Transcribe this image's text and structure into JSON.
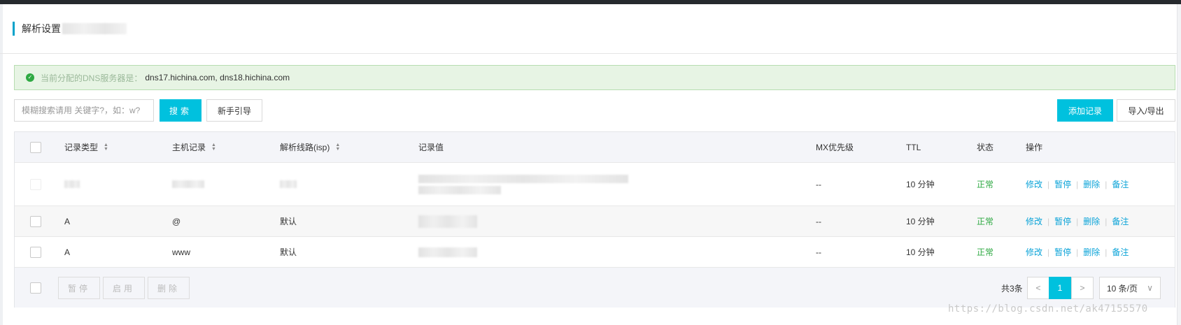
{
  "header": {
    "title": "解析设置"
  },
  "alert": {
    "label": "当前分配的DNS服务器是：",
    "servers": "dns17.hichina.com, dns18.hichina.com",
    "icon": "check-circle-icon",
    "color": "#2fa943"
  },
  "toolbar": {
    "search_placeholder": "模糊搜索请用 关键字?，如：w?",
    "search_label": "搜索",
    "guide_label": "新手引导",
    "add_label": "添加记录",
    "import_export_label": "导入/导出"
  },
  "table": {
    "columns": {
      "type": "记录类型",
      "host": "主机记录",
      "line": "解析线路(isp)",
      "value": "记录值",
      "mx": "MX优先级",
      "ttl": "TTL",
      "status": "状态",
      "ops": "操作"
    },
    "rows": [
      {
        "type": "",
        "host": "",
        "line": "",
        "value": "",
        "mx": "--",
        "ttl": "10 分钟",
        "status": "正常"
      },
      {
        "type": "A",
        "host": "@",
        "line": "默认",
        "value": "",
        "mx": "--",
        "ttl": "10 分钟",
        "status": "正常"
      },
      {
        "type": "A",
        "host": "www",
        "line": "默认",
        "value": "",
        "mx": "--",
        "ttl": "10 分钟",
        "status": "正常"
      }
    ],
    "ops": {
      "edit": "修改",
      "pause": "暂停",
      "delete": "删除",
      "note": "备注"
    }
  },
  "footer": {
    "pause_label": "暂停",
    "enable_label": "启用",
    "delete_label": "删除",
    "total": "共3条",
    "prev": "<",
    "current_page": "1",
    "next": ">",
    "page_size": "10 条/页",
    "page_size_caret": "∨"
  },
  "watermark": "https://blog.csdn.net/ak47155570",
  "colors": {
    "accent": "#00c1de",
    "link": "#0aa3d8",
    "ok": "#2fa943"
  }
}
